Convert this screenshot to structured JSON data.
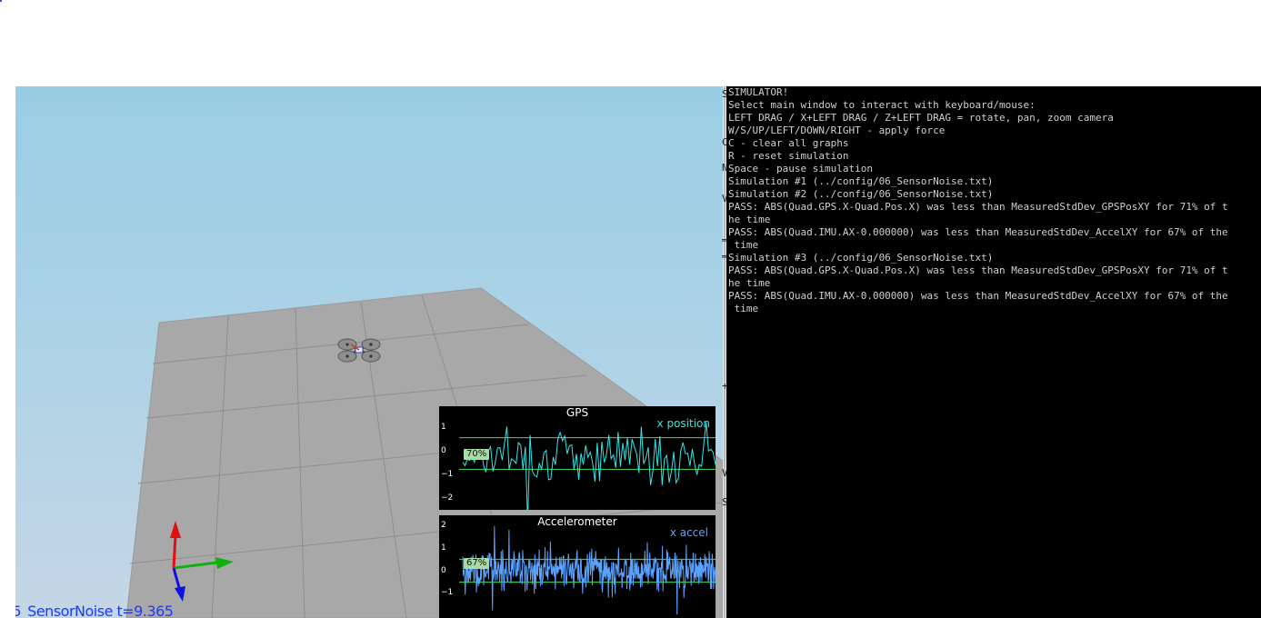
{
  "status_bar": {
    "scenario_label": "6_SensorNoise t=9.365"
  },
  "gps_graph": {
    "title": "GPS",
    "series_label": "x position",
    "y_ticks": [
      "1",
      "0",
      "−1",
      "−2"
    ],
    "percent_badge": "70%",
    "line_color": "#2fe8e8",
    "threshold_color": "#3ec24a",
    "threshold": 0.67
  },
  "accel_graph": {
    "title": "Accelerometer",
    "series_label": "x accel",
    "y_ticks": [
      "2",
      "1",
      "0",
      "−1"
    ],
    "percent_badge": "67%",
    "line_color": "#5aa2ff",
    "threshold_color": "#3ec24a",
    "threshold": 0.5
  },
  "divider_glyphs": [
    "S",
    "C",
    "N",
    "V",
    "═",
    "═",
    "+",
    "V",
    "S"
  ],
  "console": {
    "lines": [
      "SIMULATOR!",
      "Select main window to interact with keyboard/mouse:",
      "LEFT DRAG / X+LEFT DRAG / Z+LEFT DRAG = rotate, pan, zoom camera",
      "W/S/UP/LEFT/DOWN/RIGHT - apply force",
      "C - clear all graphs",
      "R - reset simulation",
      "Space - pause simulation",
      "Simulation #1 (../config/06_SensorNoise.txt)",
      "Simulation #2 (../config/06_SensorNoise.txt)",
      "PASS: ABS(Quad.GPS.X-Quad.Pos.X) was less than MeasuredStdDev_GPSPosXY for 71% of t",
      "he time",
      "PASS: ABS(Quad.IMU.AX-0.000000) was less than MeasuredStdDev_AccelXY for 67% of the",
      " time",
      "Simulation #3 (../config/06_SensorNoise.txt)",
      "PASS: ABS(Quad.GPS.X-Quad.Pos.X) was less than MeasuredStdDev_GPSPosXY for 71% of t",
      "he time",
      "PASS: ABS(Quad.IMU.AX-0.000000) was less than MeasuredStdDev_AccelXY for 67% of the",
      " time"
    ]
  },
  "colors": {
    "sky_top": "#99cde4",
    "floor": "#a8a8a8",
    "console_bg": "#000000",
    "console_text": "#cfcfcf",
    "status_text": "#1a3aff"
  }
}
